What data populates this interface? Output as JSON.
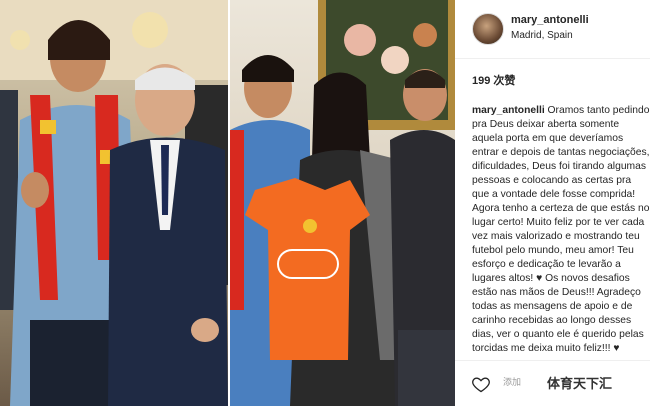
{
  "post": {
    "username": "mary_antonelli",
    "location": "Madrid, Spain",
    "likes": "199 次赞",
    "caption_user": "mary_antonelli",
    "caption_text": " Oramos tanto pedindo pra Deus deixar aberta somente aquela porta em que deveríamos entrar e depois de tantas negociações, dificuldades, Deus foi tirando algumas pessoas e colocando as certas pra que a vontade dele fosse comprida! Agora tenho a certeza de que estás no lugar certo! Muito feliz por te ver cada vez mais valorizado e mostrando teu futebol pelo mundo, meu amor! Teu esforço e dedicação te levarão a lugares altos! ♥ Os novos desafios estão nas mãos de Deus!!! Agradeço todas as mensagens de apoio e de carinho recebidas ao longo desses dias, ver o quanto ele é querido pelas torcidas me deixa muito feliz!!! ♥"
  },
  "footer": {
    "add_label": "添加",
    "watermark": "体育天下汇"
  },
  "colors": {
    "scarf_red": "#d8291f",
    "scarf_yellow": "#f2c230",
    "jersey_orange": "#f36b21"
  }
}
